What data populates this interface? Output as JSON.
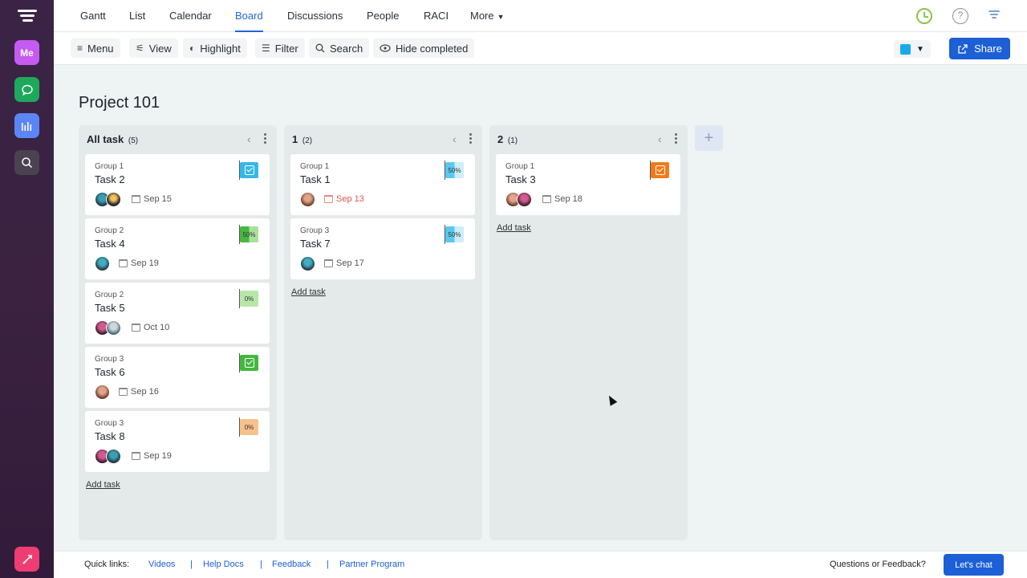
{
  "nav": {
    "tabs": [
      "Gantt",
      "List",
      "Calendar",
      "Board",
      "Discussions",
      "People",
      "RACI",
      "More"
    ],
    "active_tab": "Board"
  },
  "rail": {
    "me_label": "Me"
  },
  "toolbar": {
    "menu": "Menu",
    "view": "View",
    "highlight": "Highlight",
    "filter": "Filter",
    "search": "Search",
    "hide_completed": "Hide completed",
    "share": "Share",
    "color": "#1aa9e8"
  },
  "project": {
    "title": "Project 101"
  },
  "columns": [
    {
      "title": "All task",
      "count": "(5)",
      "cards": [
        {
          "group": "Group 1",
          "name": "Task 2",
          "due": "Sep 15",
          "badge": "✓"
        },
        {
          "group": "Group 2",
          "name": "Task 4",
          "due": "Sep 19",
          "badge": "50%"
        },
        {
          "group": "Group 2",
          "name": "Task 5",
          "due": "Oct 10",
          "badge": "0%"
        },
        {
          "group": "Group 3",
          "name": "Task 6",
          "due": "Sep 16",
          "badge": "✓"
        },
        {
          "group": "Group 3",
          "name": "Task 8",
          "due": "Sep 19",
          "badge": "0%"
        }
      ],
      "add_task": "Add task"
    },
    {
      "title": "1",
      "count": "(2)",
      "cards": [
        {
          "group": "Group 1",
          "name": "Task 1",
          "due": "Sep 13",
          "badge": "50%"
        },
        {
          "group": "Group 3",
          "name": "Task 7",
          "due": "Sep 17",
          "badge": "50%"
        }
      ],
      "add_task": "Add task"
    },
    {
      "title": "2",
      "count": "(1)",
      "cards": [
        {
          "group": "Group 1",
          "name": "Task 3",
          "due": "Sep 18",
          "badge": "✓"
        }
      ],
      "add_task": "Add task"
    }
  ],
  "footer": {
    "quick_links": "Quick links:",
    "links": [
      "Videos",
      "Help Docs",
      "Feedback",
      "Partner Program"
    ],
    "sep": "|",
    "questions": "Questions or Feedback?",
    "chat": "Let's chat"
  },
  "colors": {
    "accent": "#1c5fd6",
    "late": "#e0554f",
    "rail": "#3b2346"
  }
}
